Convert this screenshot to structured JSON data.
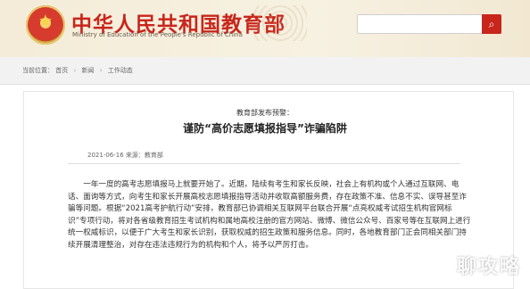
{
  "header": {
    "title": "中华人民共和国教育部",
    "subtitle": "Ministry of Education of the People's Republic of China",
    "emblem_glyph": "★",
    "search": {
      "placeholder": "",
      "button_icon": "search-icon"
    }
  },
  "breadcrumb": {
    "label": "当前位置：",
    "items": [
      "首页",
      "新闻",
      "工作动态"
    ],
    "separator": "›"
  },
  "article": {
    "kicker": "教育部发布预警：",
    "title": "谨防“高价志愿填报指导”诈骗陷阱",
    "meta": "2021-06-16    来源：教育部",
    "body": "一年一度的高考志愿填报马上就要开始了。近期，陆续有考生和家长反映，社会上有机构或个人通过互联网、电话、面询等方式，向考生和家长开展高校志愿填报指导活动并收取高额服务费，存在政策不准、信息不实、误导甚至诈骗等问题。根据“2021高考护航行动”安排，教育部已协调相关互联网平台联合开展“点亮权威考试招生机构官网标识”专项行动，将对各省级教育招生考试机构和属地高校注册的官方网站、微博、微信公众号、百家号等在互联网上进行统一权威标识，以便于广大考生和家长识别，获取权威的招生政策和服务信息。同时，各地教育部门正会同相关部门持续开展清理整治，对存在违法违规行为的机构和个人，将予以严厉打击。"
  },
  "watermark": "聊攻略",
  "colors": {
    "brand_red": "#c8261c",
    "header_bg": "#f4ecd8"
  }
}
